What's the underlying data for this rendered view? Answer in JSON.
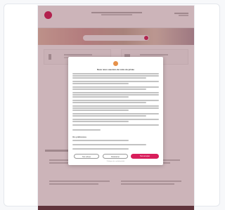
{
  "modal": {
    "title": "Nous nous soucions de votre vie privée",
    "preferences_heading": "Vos préférences",
    "reject_label": "Tout refuser",
    "manage_label": "Paramétrer",
    "accept_label": "Tout accepter",
    "footer": "Politique de confidentialité"
  },
  "colors": {
    "brand": "#d81e5b",
    "modal_logo": "#e6914a",
    "overlay": "rgba(110,40,55,0.35)",
    "footer": "#5a3a3e"
  },
  "icons": {
    "brand_logo": "circle-logo-icon",
    "search_button": "search-icon",
    "modal_logo": "brand-mark-icon"
  }
}
